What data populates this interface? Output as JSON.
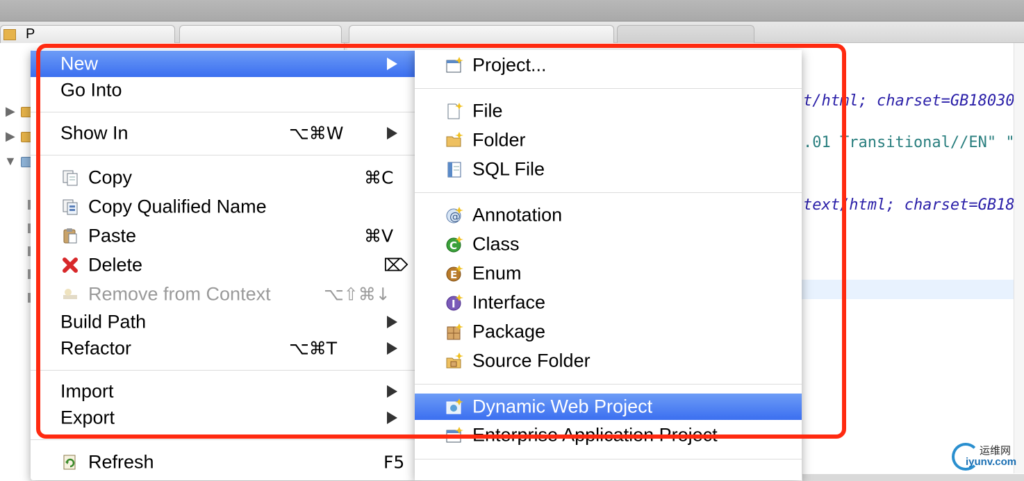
{
  "background": {
    "explorer_tab_prefix": "P",
    "code_lines": [
      "t/html; charset=GB18030",
      ".01 Transitional//EN\" \"",
      "text/html; charset=GB18"
    ]
  },
  "context_menu": {
    "items": [
      {
        "label": "New",
        "selected": true,
        "submenu": true
      },
      {
        "label": "Go Into"
      },
      {
        "label": "Show In",
        "shortcut": "⌥⌘W",
        "submenu": true
      },
      {
        "label": "Copy",
        "shortcut": "⌘C",
        "icon": "copy-icon"
      },
      {
        "label": "Copy Qualified Name",
        "icon": "copy-qualified-name-icon"
      },
      {
        "label": "Paste",
        "shortcut": "⌘V",
        "icon": "paste-icon"
      },
      {
        "label": "Delete",
        "shortcut": "⌦",
        "icon": "delete-icon"
      },
      {
        "label": "Remove from Context",
        "shortcut": "⌥⇧⌘↓",
        "disabled": true,
        "icon": "remove-context-icon"
      },
      {
        "label": "Build Path",
        "submenu": true
      },
      {
        "label": "Refactor",
        "shortcut": "⌥⌘T",
        "submenu": true
      },
      {
        "label": "Import",
        "submenu": true
      },
      {
        "label": "Export",
        "submenu": true
      },
      {
        "label": "Refresh",
        "shortcut": "F5",
        "icon": "refresh-icon"
      }
    ]
  },
  "new_submenu": {
    "items": [
      {
        "label": "Project...",
        "icon": "project-icon"
      },
      {
        "label": "File",
        "icon": "file-icon"
      },
      {
        "label": "Folder",
        "icon": "folder-icon"
      },
      {
        "label": "SQL File",
        "icon": "sql-file-icon"
      },
      {
        "label": "Annotation",
        "icon": "annotation-icon"
      },
      {
        "label": "Class",
        "icon": "class-icon"
      },
      {
        "label": "Enum",
        "icon": "enum-icon"
      },
      {
        "label": "Interface",
        "icon": "interface-icon"
      },
      {
        "label": "Package",
        "icon": "package-icon"
      },
      {
        "label": "Source Folder",
        "icon": "source-folder-icon"
      },
      {
        "label": "Dynamic Web Project",
        "selected": true,
        "icon": "dynamic-web-project-icon"
      },
      {
        "label": "Enterprise Application Project",
        "icon": "enterprise-project-icon"
      }
    ]
  },
  "colors": {
    "selection": "#3b6ff0",
    "annotation": "#ff2a10",
    "code_keyword": "#2a1fa8",
    "code_string": "#2a7f7f"
  },
  "watermark": {
    "line1": "运维网",
    "line2": "iyunv.com"
  }
}
